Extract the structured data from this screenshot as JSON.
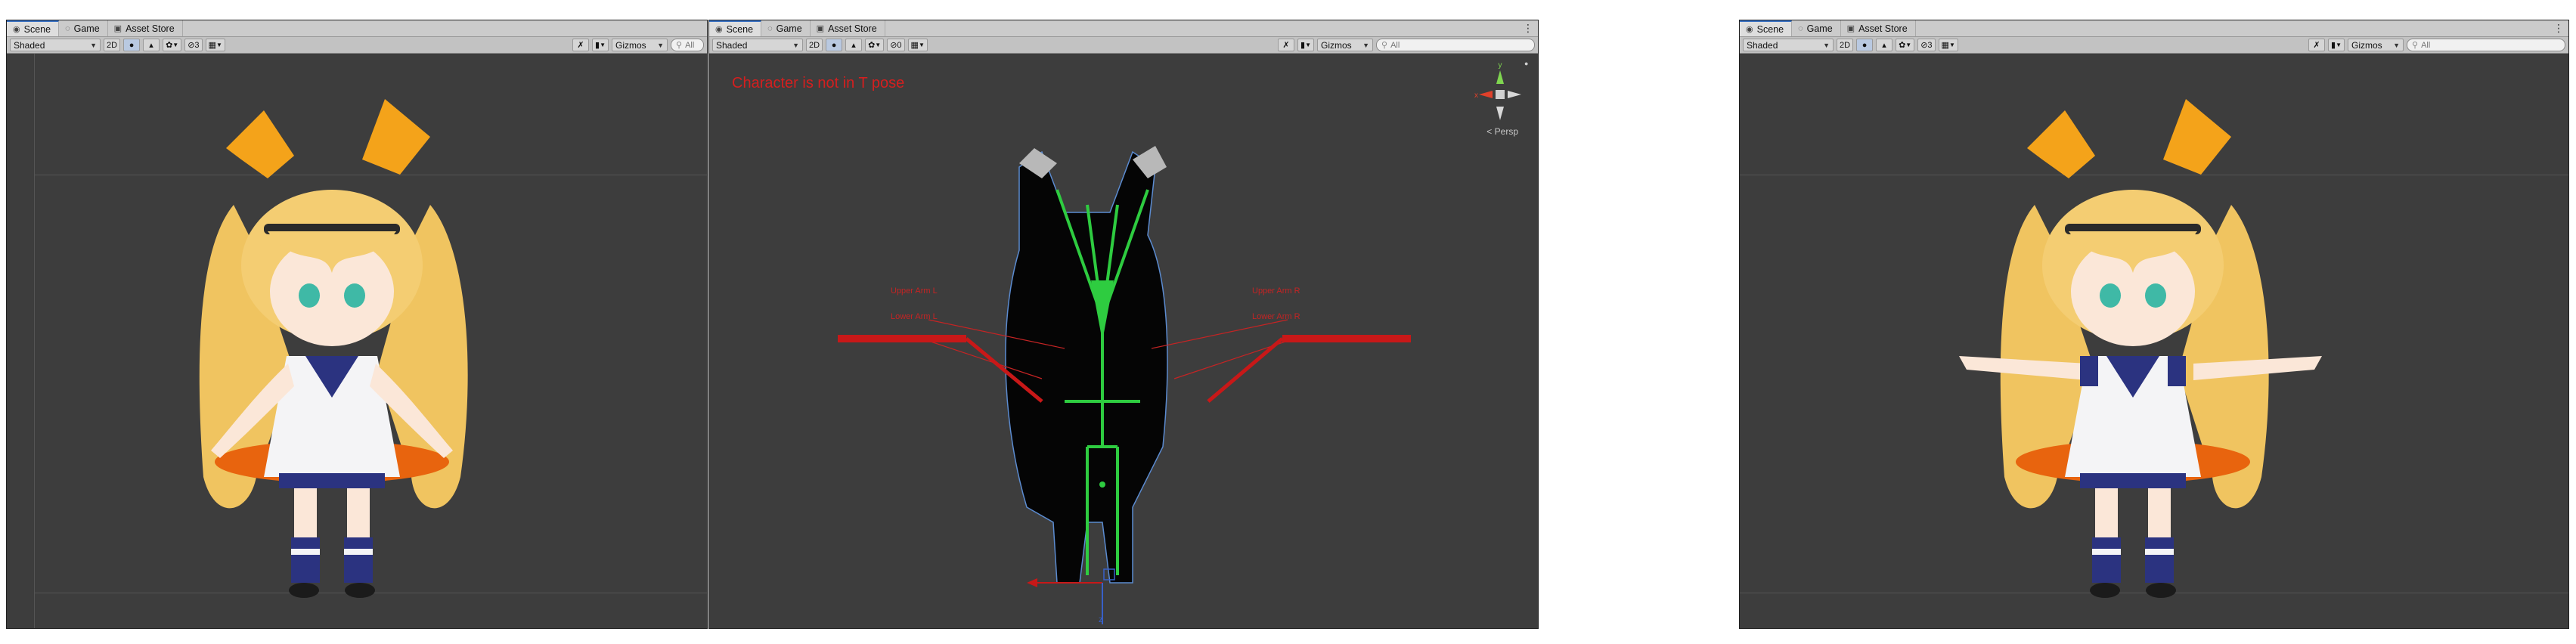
{
  "editors": [
    {
      "id": "left",
      "tabs": [
        {
          "label": "Scene",
          "icon": "scene-icon",
          "active": true
        },
        {
          "label": "Game",
          "icon": "game-icon",
          "active": false
        },
        {
          "label": "Asset Store",
          "icon": "store-icon",
          "active": false
        }
      ],
      "toolbar": {
        "draw_mode": "Shaded",
        "mode_2d": "2D",
        "hidden_count": "3",
        "gizmos": "Gizmos",
        "search_placeholder": "All"
      }
    },
    {
      "id": "middle",
      "tabs": [
        {
          "label": "Scene",
          "icon": "scene-icon",
          "active": true
        },
        {
          "label": "Game",
          "icon": "game-icon",
          "active": false
        },
        {
          "label": "Asset Store",
          "icon": "store-icon",
          "active": false
        }
      ],
      "toolbar": {
        "draw_mode": "Shaded",
        "mode_2d": "2D",
        "hidden_count": "0",
        "gizmos": "Gizmos",
        "search_placeholder": "All"
      },
      "overlay": {
        "warning": "Character is not in T pose",
        "persp_label": "Persp",
        "gizmo_axes": {
          "y": "y",
          "x": "x",
          "z": "z"
        },
        "muscle_labels": [
          "Upper Arm L",
          "Lower Arm L",
          "Upper Arm R",
          "Lower Arm R"
        ]
      }
    },
    {
      "id": "right",
      "tabs": [
        {
          "label": "Scene",
          "icon": "scene-icon",
          "active": true
        },
        {
          "label": "Game",
          "icon": "game-icon",
          "active": false
        },
        {
          "label": "Asset Store",
          "icon": "store-icon",
          "active": false
        }
      ],
      "toolbar": {
        "draw_mode": "Shaded",
        "mode_2d": "2D",
        "hidden_count": "3",
        "gizmos": "Gizmos",
        "search_placeholder": "All"
      }
    }
  ],
  "colors": {
    "viewport_bg": "#3d3d3d",
    "tab_active_accent": "#3a72c2",
    "warning_red": "#d41f1f",
    "bone_green": "#2ecc40",
    "hair_blonde": "#f2c96a",
    "ribbon_orange": "#f4a31a"
  }
}
